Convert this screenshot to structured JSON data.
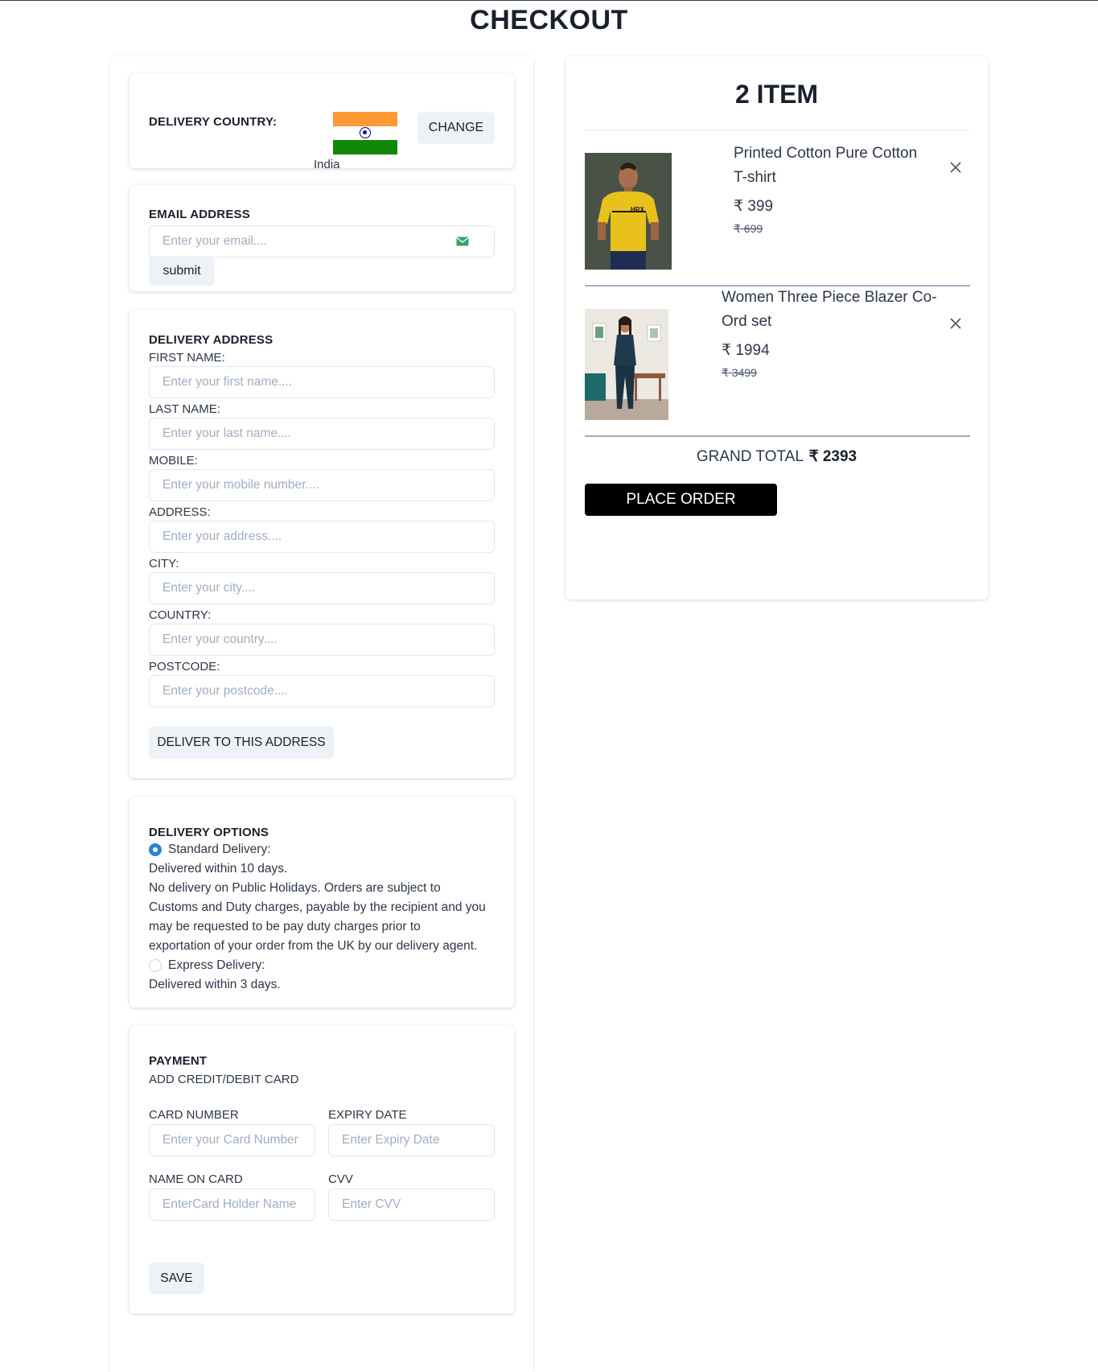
{
  "page": {
    "title": "CHECKOUT"
  },
  "delivery_country": {
    "label": "DELIVERY COUNTRY:",
    "country_name": "India",
    "change_label": "CHANGE"
  },
  "email": {
    "heading": "EMAIL ADDRESS",
    "placeholder": "Enter your email....",
    "submit_label": "submit"
  },
  "address": {
    "heading": "DELIVERY ADDRESS",
    "fields": [
      {
        "label": "FIRST NAME:",
        "placeholder": "Enter your first name...."
      },
      {
        "label": "LAST NAME:",
        "placeholder": "Enter your last name...."
      },
      {
        "label": "MOBILE:",
        "placeholder": "Enter your mobile number...."
      },
      {
        "label": "ADDRESS:",
        "placeholder": "Enter your address...."
      },
      {
        "label": "CITY:",
        "placeholder": "Enter your city...."
      },
      {
        "label": "COUNTRY:",
        "placeholder": "Enter your country...."
      },
      {
        "label": "POSTCODE:",
        "placeholder": "Enter your postcode...."
      }
    ],
    "submit_label": "DELIVER TO THIS ADDRESS"
  },
  "delivery_options": {
    "heading": "DELIVERY OPTIONS",
    "standard": {
      "label": "Standard Delivery:",
      "detail": "Delivered within 10 days.",
      "note_lines": [
        "No delivery on Public Holidays. Orders are subject to",
        "Customs and Duty charges, payable by the recipient and you",
        "may be requested to be pay duty charges prior to",
        "exportation of your order from the UK by our delivery agent."
      ],
      "selected": true
    },
    "express": {
      "label": "Express Delivery:",
      "detail": "Delivered within 3 days.",
      "selected": false
    }
  },
  "payment": {
    "heading": "PAYMENT",
    "subheading": "ADD CREDIT/DEBIT CARD",
    "card_number_label": "CARD NUMBER",
    "card_number_placeholder": "Enter your Card Number",
    "expiry_label": "EXPIRY DATE",
    "expiry_placeholder": "Enter Expiry Date",
    "name_label": "NAME ON CARD",
    "name_placeholder": "EnterCard Holder Name",
    "cvv_label": "CVV",
    "cvv_placeholder": "Enter CVV",
    "save_label": "SAVE"
  },
  "cart": {
    "heading": "2 ITEM",
    "items": [
      {
        "name_line1": "Printed Cotton Pure Cotton",
        "name_line2": "T-shirt",
        "price": "₹ 399",
        "original_price": "₹ 699",
        "shirt_text": "HRX"
      },
      {
        "name_line1": "Women Three Piece Blazer Co-",
        "name_line2": "Ord set",
        "price": "₹ 1994",
        "original_price": "₹ 3499"
      }
    ],
    "grand_total_label": "GRAND TOTAL",
    "grand_total_value": "₹ 2393",
    "place_order_label": "PLACE ORDER"
  },
  "icons": {
    "email": "envelope-icon",
    "remove": "close-icon"
  },
  "colors": {
    "accent": "#3182ce",
    "button_grey": "#edf2f7",
    "place_order_bg": "#000000",
    "email_icon": "#38a169"
  }
}
